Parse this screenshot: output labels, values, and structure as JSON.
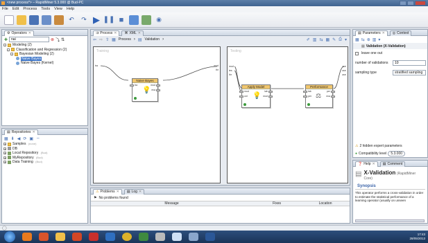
{
  "window": {
    "title": "<new process*> – RapidMiner 5.3.000 @ Bud-PC"
  },
  "menubar": [
    "File",
    "Edit",
    "Process",
    "Tools",
    "View",
    "Help"
  ],
  "operators_panel": {
    "tab_label": "Operators",
    "search_value": "nai",
    "tree": [
      {
        "label": "Modeling (2)",
        "depth": 0,
        "icon": "folder"
      },
      {
        "label": "Classification and Regression (2)",
        "depth": 1,
        "icon": "folder"
      },
      {
        "label": "Bayesian Modeling (2)",
        "depth": 2,
        "icon": "folder"
      },
      {
        "label": "Naive Bayes",
        "depth": 3,
        "icon": "op",
        "selected": true
      },
      {
        "label": "Naive Bayes (Kernel)",
        "depth": 3,
        "icon": "op"
      }
    ]
  },
  "repositories_panel": {
    "tab_label": "Repositories",
    "tree": [
      {
        "label": "Samples",
        "note": "(none)",
        "icon": "repo"
      },
      {
        "label": "DB",
        "note": "",
        "icon": "db"
      },
      {
        "label": "Local Repository",
        "note": "(Bud)",
        "icon": "repo"
      },
      {
        "label": "MyRepository",
        "note": "(Bud)",
        "icon": "repo"
      },
      {
        "label": "Data Training",
        "note": "(Bud)",
        "icon": "repo"
      }
    ]
  },
  "process_panel": {
    "tab_process": "Process",
    "tab_xml": "XML",
    "breadcrumb_root": "Process",
    "breadcrumb_child": "Validation",
    "training_label": "Training",
    "testing_label": "Testing",
    "operators": {
      "naive_bayes": {
        "name": "Naive Bayes",
        "ports_in": [
          "tra"
        ],
        "ports_out": [
          "mod",
          "exa"
        ]
      },
      "apply_model": {
        "name": "Apply Model",
        "ports_in": [
          "mod",
          "unl"
        ],
        "ports_out": [
          "lab",
          "mod"
        ]
      },
      "performance": {
        "name": "Performance",
        "ports_in": [
          "lab",
          "per"
        ],
        "ports_out": [
          "per",
          "exa"
        ]
      }
    },
    "training_ports_left": [
      "tra"
    ],
    "training_ports_right": [
      "mod",
      "thr"
    ],
    "testing_ports_left": [
      "mod",
      "tes",
      "thr"
    ],
    "testing_ports_right": [
      "ave",
      "ave",
      "ave"
    ]
  },
  "problems_panel": {
    "tab_problems": "Problems",
    "tab_log": "Log",
    "status": "No problems found",
    "columns": [
      "Message",
      "Fixes",
      "Location"
    ]
  },
  "parameters_panel": {
    "tab_parameters": "Parameters",
    "tab_context": "Context",
    "operator_title": "Validation (X-Validation)",
    "leave_one_out_label": "leave one out",
    "num_validations_label": "number of validations",
    "num_validations_value": "10",
    "sampling_type_label": "sampling type",
    "sampling_type_value": "stratified sampling",
    "hidden_params": "2 hidden expert parameters",
    "compat_label": "Compatibility level",
    "compat_value": "5.3.000"
  },
  "help_panel": {
    "tab_help": "Help",
    "tab_comment": "Comment",
    "operator_name": "X-Validation",
    "operator_source": "(RapidMiner Core)",
    "synopsis_heading": "Synopsis",
    "synopsis_text": "This operator performs a cross-validation in order to estimate the statistical performance of a learning operator (usually on unseen"
  },
  "taskbar": {
    "time": "17:43",
    "date": "28/05/2013"
  },
  "colors": {
    "title_bar": "#3f6390",
    "op_header": "#f0c66e",
    "selection": "#3f77c9",
    "connection": "#4a4a4a"
  }
}
